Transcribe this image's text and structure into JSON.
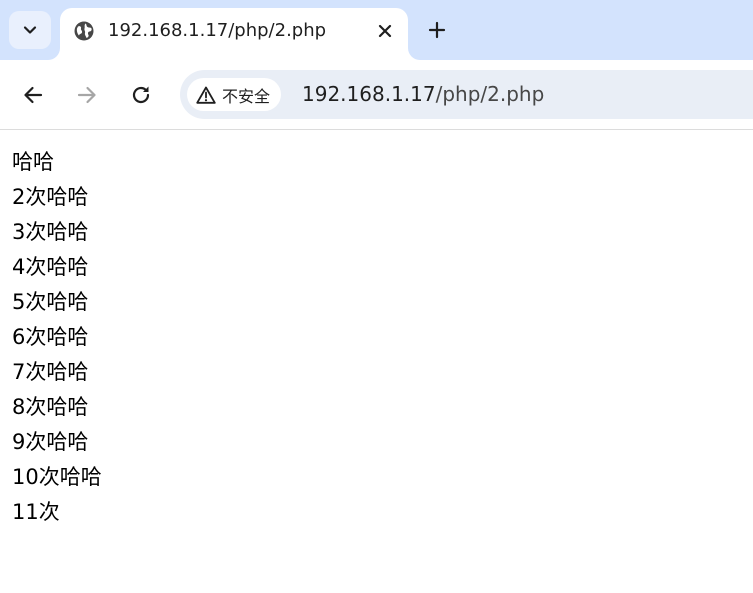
{
  "tab": {
    "title": "192.168.1.17/php/2.php",
    "favicon": "globe-icon",
    "close": "close-icon"
  },
  "tabstrip": {
    "search_tabs": "chevron-down-icon",
    "new_tab": "plus-icon"
  },
  "toolbar": {
    "back": "arrow-left-icon",
    "forward": "arrow-right-icon",
    "reload": "reload-icon"
  },
  "omnibox": {
    "security_label": "不安全",
    "security_icon": "warning-icon",
    "url_host": "192.168.1.17",
    "url_path": "/php/2.php"
  },
  "content": {
    "lines": [
      "哈哈",
      "2次哈哈",
      "3次哈哈",
      "4次哈哈",
      "5次哈哈",
      "6次哈哈",
      "7次哈哈",
      "8次哈哈",
      "9次哈哈",
      "10次哈哈",
      "11次"
    ]
  },
  "colors": {
    "tabstrip_bg": "#d3e3fd",
    "omnibox_bg": "#e9eef6",
    "tab_bg": "#ffffff",
    "icon": "#1f1f1f",
    "icon_disabled": "#a6a6a6"
  }
}
